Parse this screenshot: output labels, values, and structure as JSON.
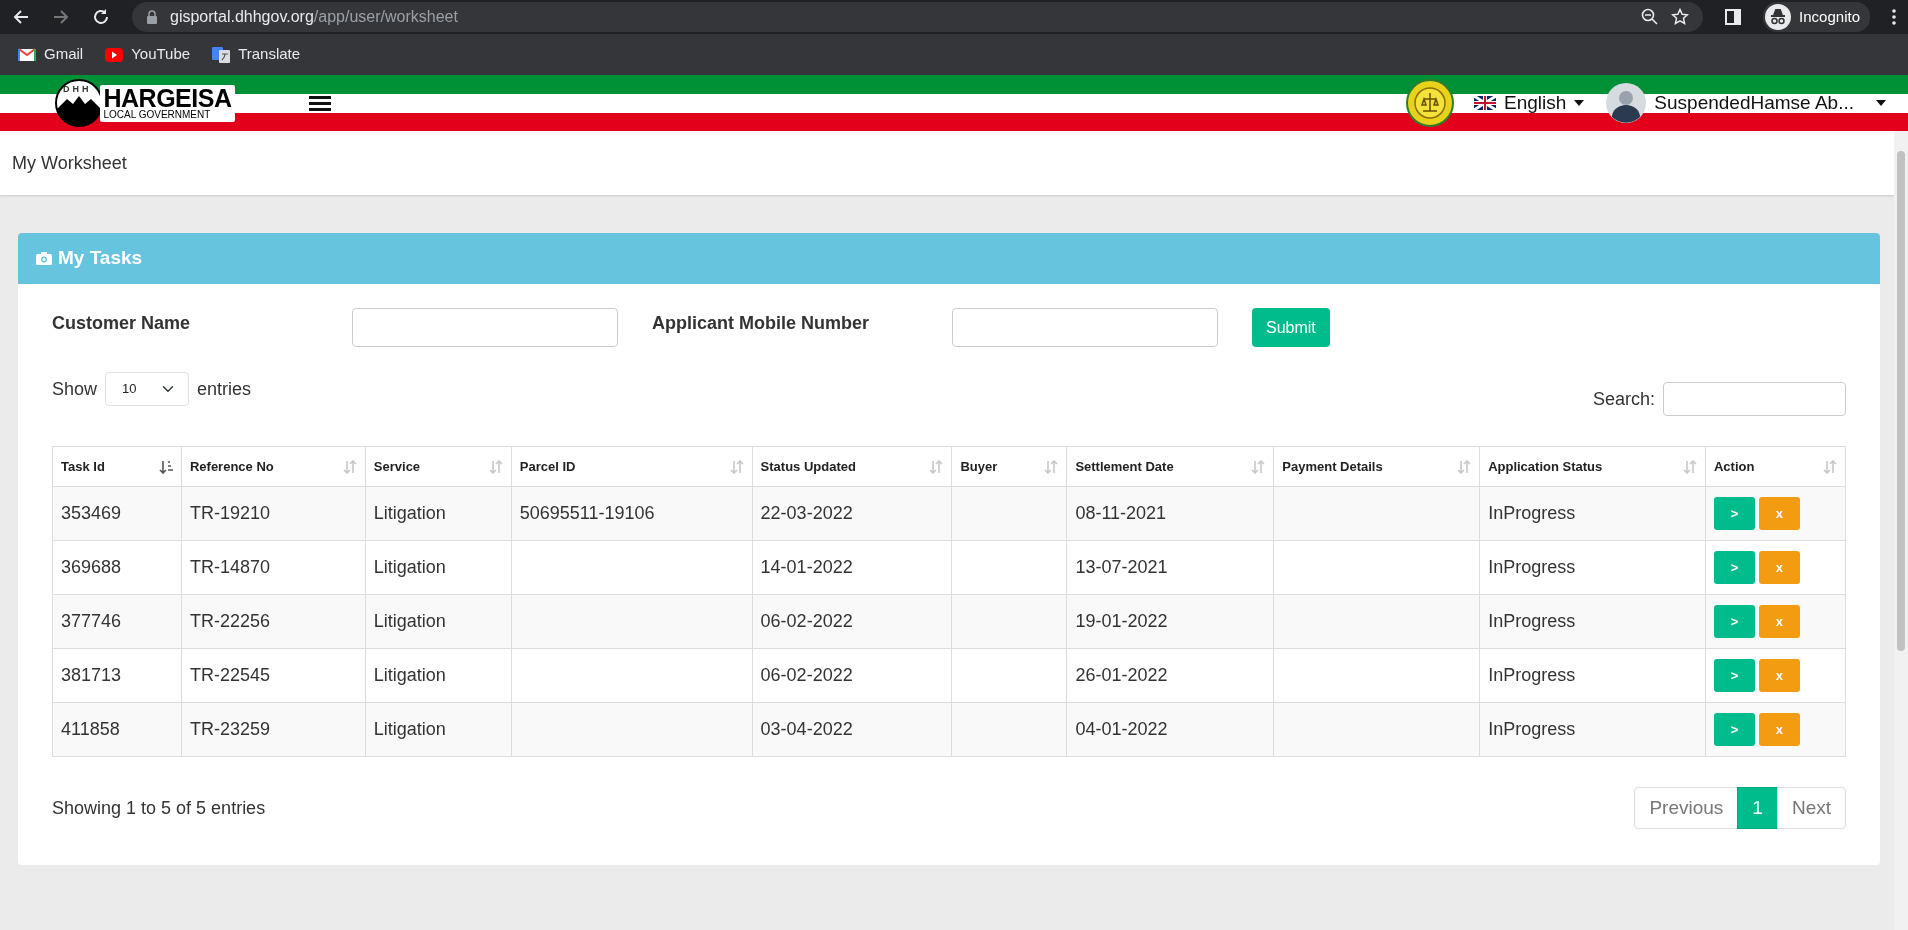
{
  "browser": {
    "url_host": "gisportal.dhhgov.org",
    "url_path": "/app/user/worksheet",
    "bookmarks": [
      "Gmail",
      "YouTube",
      "Translate"
    ],
    "profile": "Incognito"
  },
  "header": {
    "logo_title": "HARGEISA",
    "logo_subtitle": "LOCAL GOVERNMENT",
    "logo_letters": "DHH",
    "language": "English",
    "user": "SuspendedHamse Ab..."
  },
  "page_title": "My Worksheet",
  "panel": {
    "title": "My Tasks",
    "filters": [
      {
        "label": "Customer Name"
      },
      {
        "label": "Applicant Mobile Number"
      }
    ],
    "submit": "Submit",
    "show_label": "Show",
    "page_size": "10",
    "entries_label": "entries",
    "search_label": "Search:",
    "table": {
      "columns": [
        {
          "label": "Task Id",
          "sorted": true
        },
        {
          "label": "Reference No",
          "sorted": false
        },
        {
          "label": "Service",
          "sorted": false
        },
        {
          "label": "Parcel ID",
          "sorted": false
        },
        {
          "label": "Status Updated",
          "sorted": false
        },
        {
          "label": "Buyer",
          "sorted": false
        },
        {
          "label": "Settlement Date",
          "sorted": false
        },
        {
          "label": "Payment Details",
          "sorted": false
        },
        {
          "label": "Application Status",
          "sorted": false
        },
        {
          "label": "Action",
          "sorted": false
        }
      ],
      "rows": [
        {
          "cells": [
            "353469",
            "TR-19210",
            "Litigation",
            "50695511-19106",
            "22-03-2022",
            "",
            "08-11-2021",
            "",
            "InProgress"
          ],
          "actions": [
            ">",
            "x"
          ]
        },
        {
          "cells": [
            "369688",
            "TR-14870",
            "Litigation",
            "",
            "14-01-2022",
            "",
            "13-07-2021",
            "",
            "InProgress"
          ],
          "actions": [
            ">",
            "x"
          ]
        },
        {
          "cells": [
            "377746",
            "TR-22256",
            "Litigation",
            "",
            "06-02-2022",
            "",
            "19-01-2022",
            "",
            "InProgress"
          ],
          "actions": [
            ">",
            "x"
          ]
        },
        {
          "cells": [
            "381713",
            "TR-22545",
            "Litigation",
            "",
            "06-02-2022",
            "",
            "26-01-2022",
            "",
            "InProgress"
          ],
          "actions": [
            ">",
            "x"
          ]
        },
        {
          "cells": [
            "411858",
            "TR-23259",
            "Litigation",
            "",
            "03-04-2022",
            "",
            "04-01-2022",
            "",
            "InProgress"
          ],
          "actions": [
            ">",
            "x"
          ]
        }
      ]
    },
    "info": "Showing 1 to 5 of 5 entries",
    "pagination": [
      {
        "label": "Previous",
        "selected": false
      },
      {
        "label": "1",
        "selected": true
      },
      {
        "label": "Next",
        "selected": false
      }
    ]
  }
}
